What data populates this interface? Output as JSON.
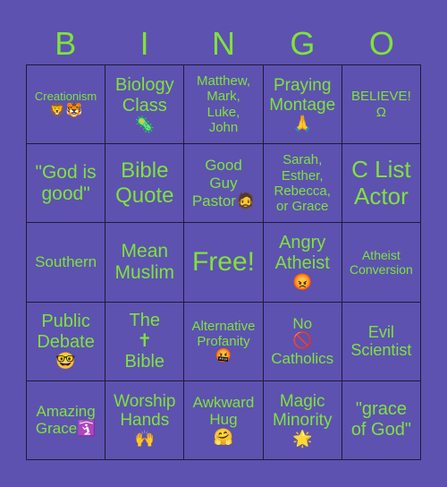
{
  "colors": {
    "background": "#5d52b0",
    "text": "#7fe33a",
    "grid_line": "#1e1a3a"
  },
  "header": {
    "letters": [
      "B",
      "I",
      "N",
      "G",
      "O"
    ]
  },
  "cells": [
    {
      "text": "Creationism",
      "icon": "🦁🐯",
      "icon_name": "lion-tiger-icon"
    },
    {
      "text": "Biology\nClass",
      "icon": "🦠",
      "icon_name": "microbe-icon"
    },
    {
      "text": "Matthew,\nMark,\nLuke,\nJohn",
      "icon": "",
      "icon_name": ""
    },
    {
      "text": "Praying\nMontage",
      "icon": "🙏",
      "icon_name": "praying-hands-icon"
    },
    {
      "text": "BELIEVE!\nΩ",
      "icon": "",
      "icon_name": ""
    },
    {
      "text": "\"God is\ngood\"",
      "icon": "",
      "icon_name": ""
    },
    {
      "text": "Bible\nQuote",
      "icon": "",
      "icon_name": ""
    },
    {
      "text": "Good\nGuy\nPastor🧔",
      "icon": "",
      "icon_name": ""
    },
    {
      "text": "Sarah,\nEsther,\nRebecca,\nor Grace",
      "icon": "",
      "icon_name": ""
    },
    {
      "text": "C List\nActor",
      "icon": "",
      "icon_name": ""
    },
    {
      "text": "Southern",
      "icon": "",
      "icon_name": ""
    },
    {
      "text": "Mean\nMuslim",
      "icon": "",
      "icon_name": ""
    },
    {
      "text": "Free!",
      "icon": "",
      "icon_name": ""
    },
    {
      "text": "Angry\nAtheist",
      "icon": "😡",
      "icon_name": "angry-face-icon"
    },
    {
      "text": "Atheist\nConversion",
      "icon": "",
      "icon_name": ""
    },
    {
      "text": "Public\nDebate",
      "icon": "🤓",
      "icon_name": "nerd-face-icon"
    },
    {
      "text": "The\n✝\nBible",
      "icon": "",
      "icon_name": ""
    },
    {
      "text": "Alternative\nProfanity",
      "icon": "🤬",
      "icon_name": "cursing-face-icon"
    },
    {
      "text": "No",
      "icon": "🚫",
      "icon_name": "prohibited-icon",
      "text2": "Catholics"
    },
    {
      "text": "Evil\nScientist",
      "icon": "",
      "icon_name": ""
    },
    {
      "text": "Amazing\nGrace🛐",
      "icon": "",
      "icon_name": ""
    },
    {
      "text": "Worship\nHands",
      "icon": "🙌",
      "icon_name": "raising-hands-icon"
    },
    {
      "text": "Awkward\nHug",
      "icon": "🤗",
      "icon_name": "hugging-face-icon"
    },
    {
      "text": "Magic\nMinority",
      "icon": "🌟",
      "icon_name": "glowing-star-icon"
    },
    {
      "text": "\"grace\nof God\"",
      "icon": "",
      "icon_name": ""
    }
  ]
}
